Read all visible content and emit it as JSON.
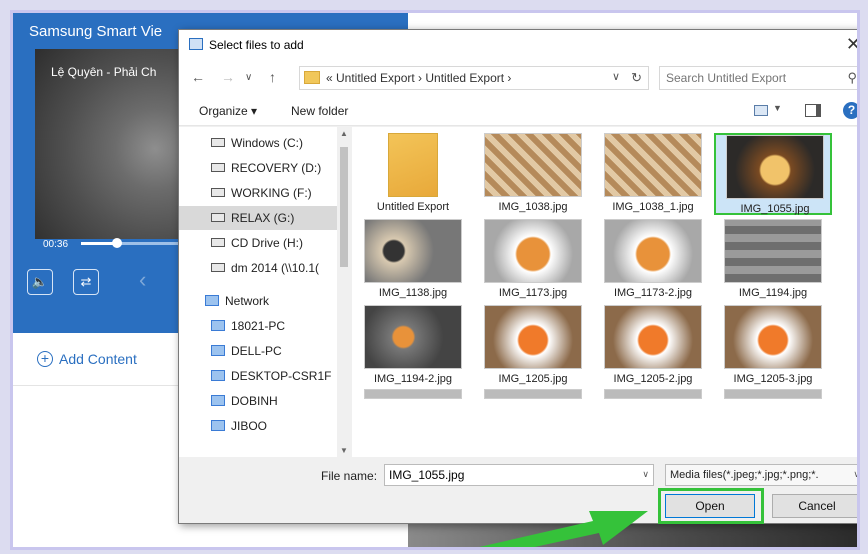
{
  "background_app": {
    "title": "Samsung Smart Vie",
    "song": "Lệ Quyên - Phải Ch",
    "time": "00:36",
    "progress_fraction": 0.3,
    "add_content": "Add Content"
  },
  "dialog": {
    "title": "Select files to add",
    "breadcrumb": "«  Untitled Export  ›  Untitled Export  ›",
    "search_placeholder": "Search Untitled Export",
    "toolbar": {
      "organize": "Organize ▾",
      "new_folder": "New folder"
    },
    "sidebar": [
      {
        "label": "Windows (C:)",
        "kind": "drive"
      },
      {
        "label": "RECOVERY (D:)",
        "kind": "drive"
      },
      {
        "label": "WORKING (F:)",
        "kind": "drive"
      },
      {
        "label": "RELAX (G:)",
        "kind": "drive",
        "selected": true
      },
      {
        "label": "CD Drive (H:)",
        "kind": "cd"
      },
      {
        "label": "dm 2014 (\\\\10.1(",
        "kind": "network-drive"
      },
      {
        "label": "Network",
        "kind": "network"
      },
      {
        "label": "18021-PC",
        "kind": "pc"
      },
      {
        "label": "DELL-PC",
        "kind": "pc"
      },
      {
        "label": "DESKTOP-CSR1F",
        "kind": "pc"
      },
      {
        "label": "DOBINH",
        "kind": "pc"
      },
      {
        "label": "JIBOO",
        "kind": "pc"
      }
    ],
    "files": [
      {
        "name": "Untitled Export",
        "kind": "folder"
      },
      {
        "name": "IMG_1038.jpg",
        "kind": "image"
      },
      {
        "name": "IMG_1038_1.jpg",
        "kind": "image"
      },
      {
        "name": "IMG_1055.jpg",
        "kind": "image",
        "selected": true
      },
      {
        "name": "IMG_1138.jpg",
        "kind": "image"
      },
      {
        "name": "IMG_1173.jpg",
        "kind": "image"
      },
      {
        "name": "IMG_1173-2.jpg",
        "kind": "image"
      },
      {
        "name": "IMG_1194.jpg",
        "kind": "image"
      },
      {
        "name": "IMG_1194-2.jpg",
        "kind": "image"
      },
      {
        "name": "IMG_1205.jpg",
        "kind": "image"
      },
      {
        "name": "IMG_1205-2.jpg",
        "kind": "image"
      },
      {
        "name": "IMG_1205-3.jpg",
        "kind": "image"
      }
    ],
    "file_name_label": "File name:",
    "file_name_value": "IMG_1055.jpg",
    "filter": "Media files(*.jpeg;*.jpg;*.png;*.",
    "open": "Open",
    "cancel": "Cancel"
  },
  "colors": {
    "accent": "#2a6fc0",
    "highlight": "#35c23a",
    "selection": "#cce4f7"
  },
  "icons": [
    "close-icon",
    "back-icon",
    "forward-icon",
    "up-icon",
    "folder-icon",
    "refresh-icon",
    "search-icon",
    "view-icon",
    "preview-pane-icon",
    "help-icon",
    "drive-icon",
    "network-icon",
    "pc-icon"
  ]
}
